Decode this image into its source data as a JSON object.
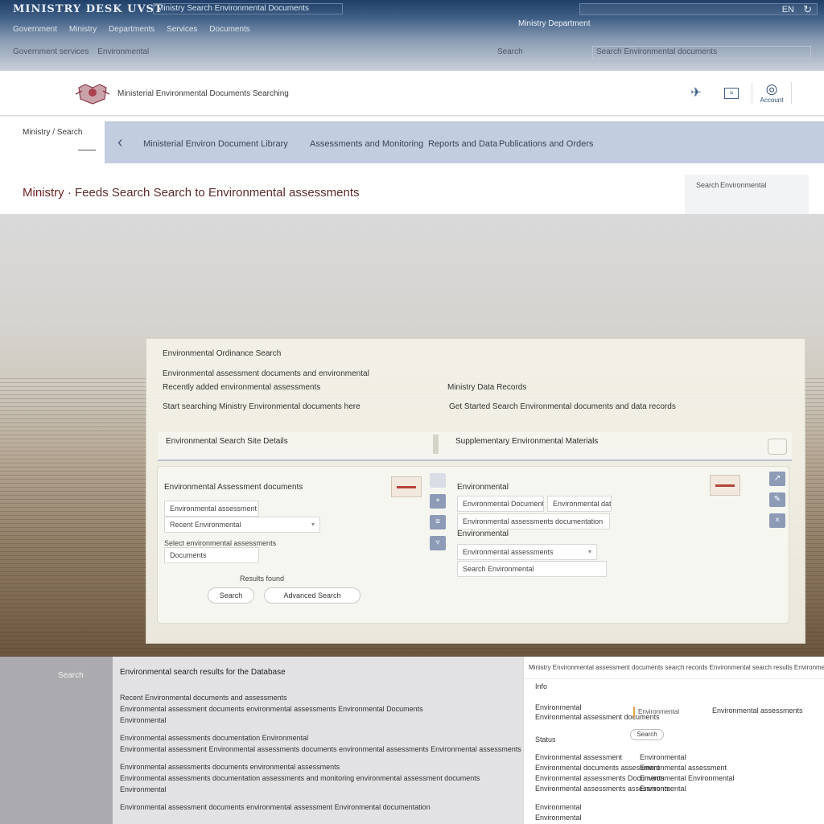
{
  "window": {
    "app_title": "MINISTRY DESK UVST",
    "url_text": "Ministry Search Environmental Documents",
    "language": "EN",
    "refresh_icon": "refresh-icon",
    "menu_row1": [
      "Government",
      "Ministry",
      "Departments",
      "Services",
      "Documents"
    ],
    "menu_right1": "Ministry Department",
    "menu_row2": [
      "Government services",
      "Environmental"
    ],
    "menu_mid2": "Search",
    "menu_right2": "Search Environmental documents"
  },
  "header": {
    "site_name": "Ministerial Environmental Documents Searching",
    "account_label": "Account"
  },
  "breadcrumb": {
    "text": "Ministry / Search"
  },
  "nav": {
    "items": [
      "Ministerial Environ Document Library",
      "Assessments and Monitoring",
      "Reports and Data",
      "Publications and Orders"
    ]
  },
  "page": {
    "title_main": "Ministry",
    "title_rest": "Feeds Search Search to Environmental assessments",
    "side_tab_a": "Search",
    "side_tab_b": "Environmental"
  },
  "panel": {
    "title": "Environmental Ordinance Search",
    "text_l1": "Environmental assessment documents and environmental",
    "text_l2": "Recently added environmental assessments",
    "text_l3": "Start searching Ministry Environmental documents here",
    "text_r1": "Ministry Data Records",
    "text_r2": "Get Started Search Environmental documents and data records",
    "tab_left": "Environmental Search Site Details",
    "tab_right": "Supplementary Environmental Materials",
    "left_label": "Environmental Assessment documents",
    "left_field1": "Environmental assessment documents",
    "left_field2": "Recent Environmental",
    "left_field3_label": "Select environmental assessments",
    "left_field3": "Documents",
    "count_label": "Results found",
    "btn_search": "Search",
    "btn_advanced": "Advanced Search",
    "right_label": "Environmental",
    "right_field1": "Environmental Documents",
    "right_field1_extra": "Environmental data",
    "right_field2": "Environmental assessments documentation",
    "right_label2": "Environmental",
    "right_field3": "Environmental assessments",
    "right_field4": "Search Environmental"
  },
  "footer": {
    "left_label": "Search",
    "head": "Environmental search results for the Database",
    "lines": [
      "Recent Environmental documents and assessments",
      "Environmental assessment documents environmental assessments Environmental Documents",
      "Environmental",
      "Environmental assessments documentation Environmental",
      "Environmental assessment Environmental assessments documents environmental assessments Environmental assessments",
      "Environmental assessments documents environmental assessments",
      "Environmental assessments documentation assessments and monitoring environmental assessment documents",
      "Environmental",
      "Environmental assessment documents environmental assessment Environmental documentation"
    ],
    "right_top": "Ministry Environmental assessment documents search records Environmental search results Environmental search records",
    "right_t1": "Info",
    "right_t2": "Environmental",
    "right_t3": "Environmental assessment documents",
    "right_field": "Environmental",
    "right_extra": "Environmental assessments",
    "right_btn": "Search",
    "right_t4": "Status",
    "right_cols": {
      "a": [
        "Environmental assessment",
        "Environmental documents assessment",
        "Environmental assessments Documents",
        "Environmental assessments assessments"
      ],
      "b": [
        "Environmental",
        "Environmental assessment",
        "Environmental Environmental",
        "Environmental"
      ],
      "c": [
        "Environmental",
        "Environmental"
      ]
    }
  }
}
